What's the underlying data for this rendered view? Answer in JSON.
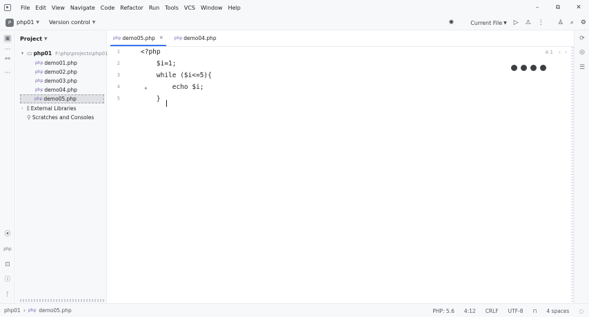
{
  "menu": [
    "File",
    "Edit",
    "View",
    "Navigate",
    "Code",
    "Refactor",
    "Run",
    "Tools",
    "VCS",
    "Window",
    "Help"
  ],
  "window_controls": [
    "–",
    "⧉",
    "✕"
  ],
  "toolbar": {
    "project_badge": "P",
    "project_name": "php01",
    "version_control": "Version control",
    "run_config": "Current File"
  },
  "project_panel": {
    "title": "Project",
    "root": {
      "name": "php01",
      "path": "F:\\php\\projects\\php01"
    },
    "files": [
      "demo01.php",
      "demo02.php",
      "demo03.php",
      "demo04.php",
      "demo05.php"
    ],
    "selected_file": "demo05.php",
    "external_libraries": "External Libraries",
    "scratches": "Scratches and Consoles"
  },
  "tabs": [
    {
      "label": "demo05.php",
      "active": true
    },
    {
      "label": "demo04.php",
      "active": false
    }
  ],
  "code_lines": [
    {
      "num": "1",
      "text": "<?php"
    },
    {
      "num": "2",
      "text": "    $i=1;"
    },
    {
      "num": "3",
      "text": "    while ($i<=5){"
    },
    {
      "num": "4",
      "text": "        echo $i;"
    },
    {
      "num": "5",
      "text": "    }"
    }
  ],
  "inspection_indicator": "A 1",
  "statusbar": {
    "crumb_project": "php01",
    "crumb_file": "demo05.php",
    "php_version": "PHP: 5.6",
    "position": "4:12",
    "line_sep": "CRLF",
    "encoding": "UTF-8",
    "indent": "4 spaces"
  }
}
